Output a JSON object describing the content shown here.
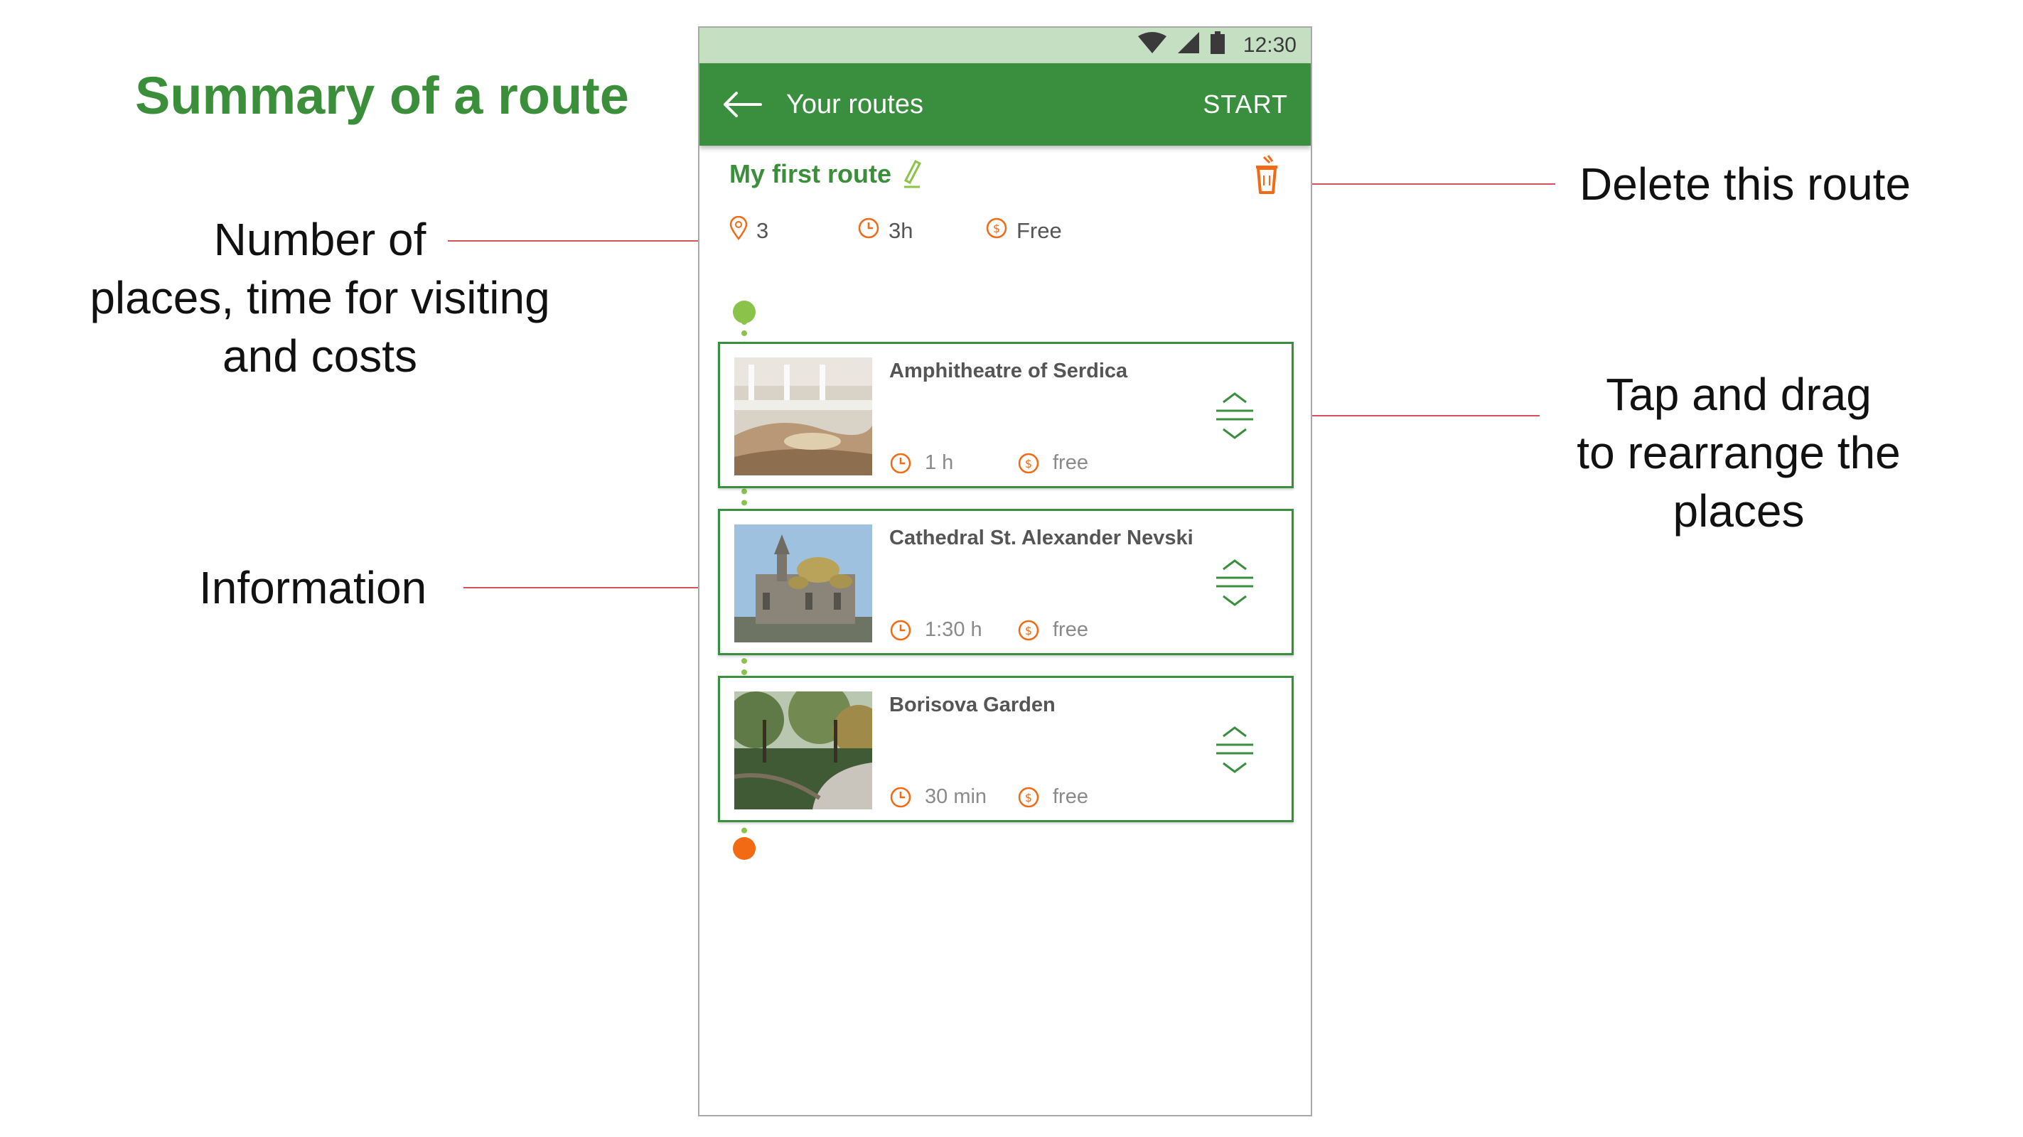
{
  "annotations": {
    "title": "Summary of a route",
    "stats_note": [
      "Number of",
      "places, time for visiting",
      "and costs"
    ],
    "info_note": "Information",
    "delete_note": "Delete this route",
    "drag_note": [
      "Tap and drag",
      "to rearrange the",
      "places"
    ]
  },
  "statusbar": {
    "time": "12:30"
  },
  "appbar": {
    "title": "Your routes",
    "action": "START"
  },
  "route": {
    "name": "My first route",
    "places_count": "3",
    "duration": "3h",
    "cost": "Free"
  },
  "places": [
    {
      "name": "Amphitheatre of Serdica",
      "duration": "1 h",
      "cost": "free"
    },
    {
      "name": "Cathedral St. Alexander Nevski",
      "duration": "1:30 h",
      "cost": "free"
    },
    {
      "name": "Borisova Garden",
      "duration": "30 min",
      "cost": "free"
    }
  ],
  "colors": {
    "brand_green": "#3a8f3e",
    "timeline_green": "#8bc34a",
    "accent_orange": "#f26a14",
    "annotation_line": "#d9505a"
  },
  "icons": [
    "wifi-icon",
    "signal-icon",
    "battery-icon",
    "back-arrow-icon",
    "pencil-icon",
    "trash-icon",
    "pin-icon",
    "clock-icon",
    "coin-icon",
    "drag-handle-icon"
  ]
}
